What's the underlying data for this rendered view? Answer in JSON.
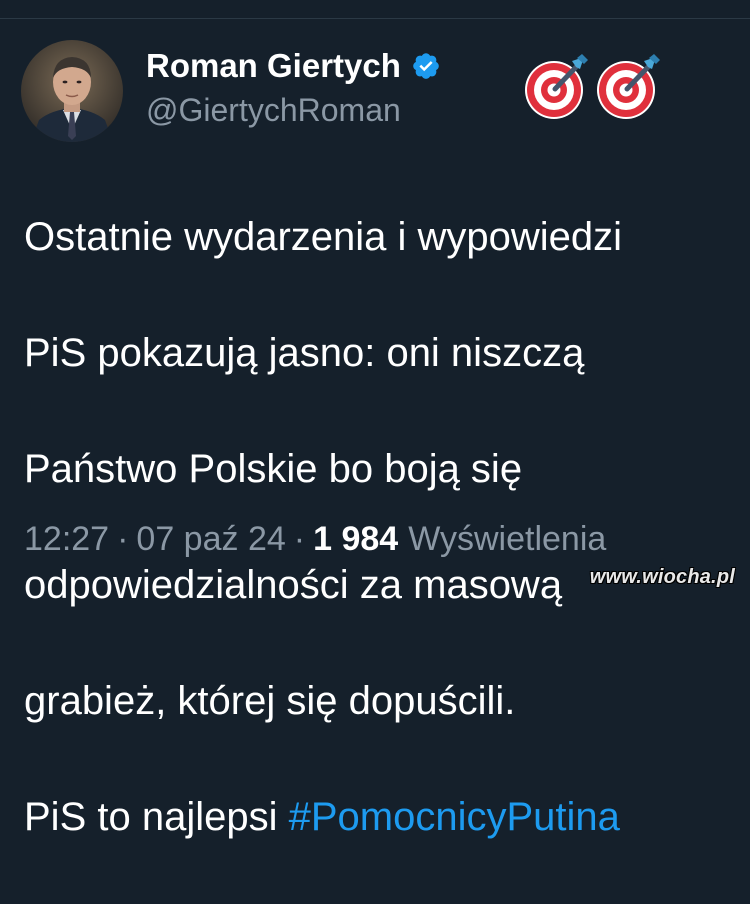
{
  "author": {
    "display_name": "Roman Giertych",
    "handle": "@GiertychRoman",
    "verified": true,
    "avatar": "author-avatar"
  },
  "emojis": [
    "target-icon",
    "target-icon"
  ],
  "tweet": {
    "lines": [
      "Ostatnie wydarzenia i wypowiedzi",
      "PiS pokazują jasno: oni niszczą",
      "Państwo Polskie bo boją się",
      "odpowiedzialności za masową",
      "grabież, której się dopuścili."
    ],
    "last_line_prefix": "PiS to najlepsi ",
    "hashtag": "#PomocnicyPutina"
  },
  "meta": {
    "time": "12:27",
    "date": "07 paź 24",
    "separator": "·",
    "views_count": "1 984",
    "views_label": "Wyświetlenia"
  },
  "watermark": "www.wiocha.pl",
  "colors": {
    "background": "#15202b",
    "text": "#ffffff",
    "secondary": "#8b98a5",
    "link": "#1d9bf0",
    "verified": "#1d9bf0"
  }
}
